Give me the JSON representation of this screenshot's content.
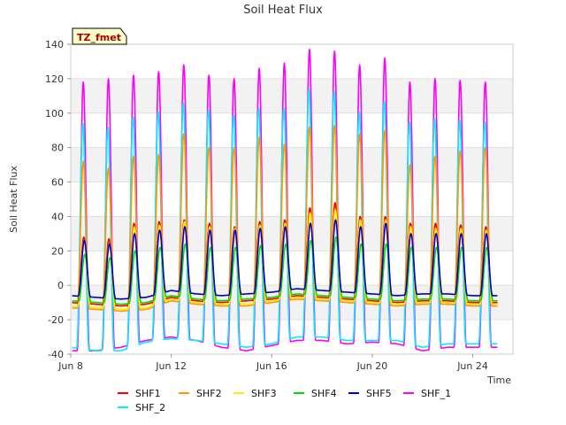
{
  "chart_data": {
    "type": "line",
    "title": "Soil Heat Flux",
    "xlabel": "Time",
    "ylabel": "Soil Heat Flux",
    "ylim": [
      -40,
      140
    ],
    "yticks": [
      -40,
      -20,
      0,
      20,
      40,
      60,
      80,
      100,
      120,
      140
    ],
    "xlim": [
      8.0,
      25.6
    ],
    "xticks": [
      {
        "value": 8,
        "label": "Jun 8"
      },
      {
        "value": 12,
        "label": "Jun 12"
      },
      {
        "value": 16,
        "label": "Jun 16"
      },
      {
        "value": 20,
        "label": "Jun 20"
      },
      {
        "value": 24,
        "label": "Jun 24"
      }
    ],
    "days": [
      8.5,
      9.5,
      10.5,
      11.5,
      12.5,
      13.5,
      14.5,
      15.5,
      16.5,
      17.5,
      18.5,
      19.5,
      20.5,
      21.5,
      22.5,
      23.5,
      24.5
    ],
    "grid": "horizontal bands",
    "legend_position": "bottom",
    "annotation": "TZ_fmet",
    "colors": {
      "SHF1": "#ff0000",
      "SHF2": "#ff9900",
      "SHF3": "#ffee00",
      "SHF4": "#00dd00",
      "SHF5": "#0000cc",
      "SHF_1": "#ff00ff",
      "SHF_2": "#00eeff"
    },
    "series": [
      {
        "name": "SHF1",
        "min": [
          -10,
          -11,
          -12,
          -11,
          -7,
          -9,
          -10,
          -9,
          -8,
          -6,
          -7,
          -8,
          -9,
          -10,
          -9,
          -9,
          -10
        ],
        "max": [
          28,
          27,
          36,
          37,
          38,
          36,
          34,
          37,
          38,
          45,
          48,
          40,
          40,
          36,
          36,
          35,
          34
        ]
      },
      {
        "name": "SHF2",
        "min": [
          -13,
          -14,
          -15,
          -14,
          -9,
          -11,
          -12,
          -12,
          -10,
          -8,
          -9,
          -10,
          -11,
          -12,
          -11,
          -11,
          -12
        ],
        "max": [
          72,
          68,
          75,
          76,
          88,
          80,
          80,
          86,
          82,
          92,
          93,
          88,
          90,
          70,
          75,
          78,
          80
        ]
      },
      {
        "name": "SHF3",
        "min": [
          -12,
          -13,
          -14,
          -13,
          -8,
          -10,
          -11,
          -11,
          -9,
          -7,
          -8,
          -9,
          -10,
          -11,
          -10,
          -10,
          -11
        ],
        "max": [
          26,
          24,
          34,
          35,
          37,
          34,
          33,
          35,
          36,
          42,
          44,
          38,
          38,
          34,
          33,
          33,
          32
        ]
      },
      {
        "name": "SHF4",
        "min": [
          -9,
          -10,
          -11,
          -10,
          -6,
          -8,
          -9,
          -8,
          -7,
          -5,
          -6,
          -7,
          -8,
          -9,
          -8,
          -8,
          -9
        ],
        "max": [
          18,
          16,
          20,
          22,
          24,
          22,
          22,
          23,
          24,
          26,
          28,
          24,
          24,
          22,
          22,
          22,
          22
        ]
      },
      {
        "name": "SHF5",
        "min": [
          -6,
          -7,
          -8,
          -7,
          -3,
          -5,
          -6,
          -5,
          -4,
          -2,
          -3,
          -4,
          -5,
          -6,
          -5,
          -5,
          -6
        ],
        "max": [
          26,
          24,
          30,
          32,
          34,
          32,
          32,
          33,
          34,
          36,
          38,
          34,
          36,
          30,
          30,
          30,
          30
        ]
      },
      {
        "name": "SHF_1",
        "min": [
          -38,
          -38,
          -36,
          -32,
          -30,
          -32,
          -36,
          -38,
          -35,
          -32,
          -32,
          -34,
          -33,
          -34,
          -38,
          -36,
          -36
        ],
        "max": [
          118,
          120,
          122,
          124,
          128,
          122,
          120,
          126,
          129,
          137,
          136,
          128,
          132,
          118,
          120,
          119,
          118
        ]
      },
      {
        "name": "SHF_2",
        "min": [
          -36,
          -38,
          -38,
          -33,
          -31,
          -32,
          -34,
          -36,
          -34,
          -30,
          -30,
          -32,
          -32,
          -32,
          -36,
          -34,
          -34
        ],
        "max": [
          94,
          92,
          98,
          101,
          106,
          102,
          99,
          103,
          103,
          114,
          113,
          101,
          107,
          95,
          97,
          96,
          95
        ]
      }
    ]
  }
}
